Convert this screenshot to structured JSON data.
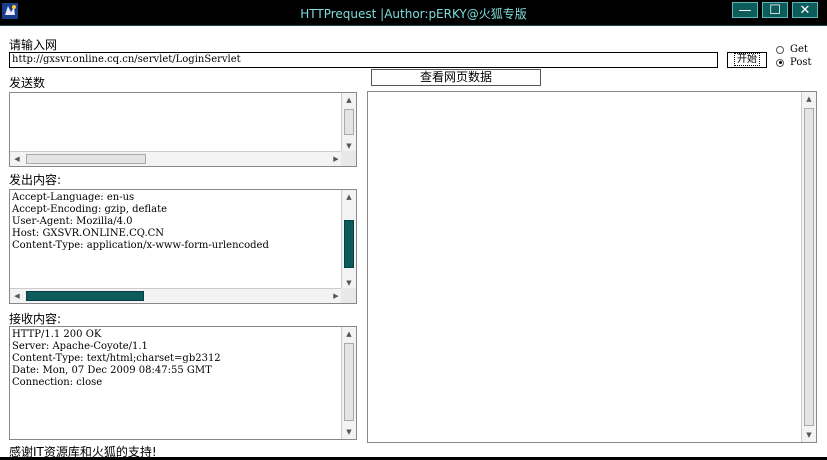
{
  "window": {
    "title": "HTTPrequest |Author:pERKY@火狐专版",
    "minimize_glyph": "—",
    "maximize_glyph": "☐",
    "close_glyph": "✕",
    "icon": "app-icon"
  },
  "url_section": {
    "label": "请输入网",
    "value": "http://gxsvr.online.cq.cn/servlet/LoginServlet",
    "start_button": "开始",
    "methods": [
      {
        "label": "Get",
        "selected": false
      },
      {
        "label": "Post",
        "selected": true
      }
    ]
  },
  "send_data": {
    "label": "发送数",
    "content": ""
  },
  "view_button": "查看网页数据",
  "sent_content": {
    "label": "发出内容:",
    "lines": "Accept-Language: en-us\nAccept-Encoding: gzip, deflate\nUser-Agent: Mozilla/4.0\nHost: GXSVR.ONLINE.CQ.CN\nContent-Type: application/x-www-form-urlencoded"
  },
  "received_content": {
    "label": "接收内容:",
    "lines": "HTTP/1.1 200 OK\nServer: Apache-Coyote/1.1\nContent-Type: text/html;charset=gb2312\nDate: Mon, 07 Dec 2009 08:47:55 GMT\nConnection: close"
  },
  "status": "感谢IT资源库和火狐的支持!",
  "colors": {
    "accent": "#0d5c5c",
    "title_text": "#7fdcdc",
    "background": "#ffffff"
  }
}
